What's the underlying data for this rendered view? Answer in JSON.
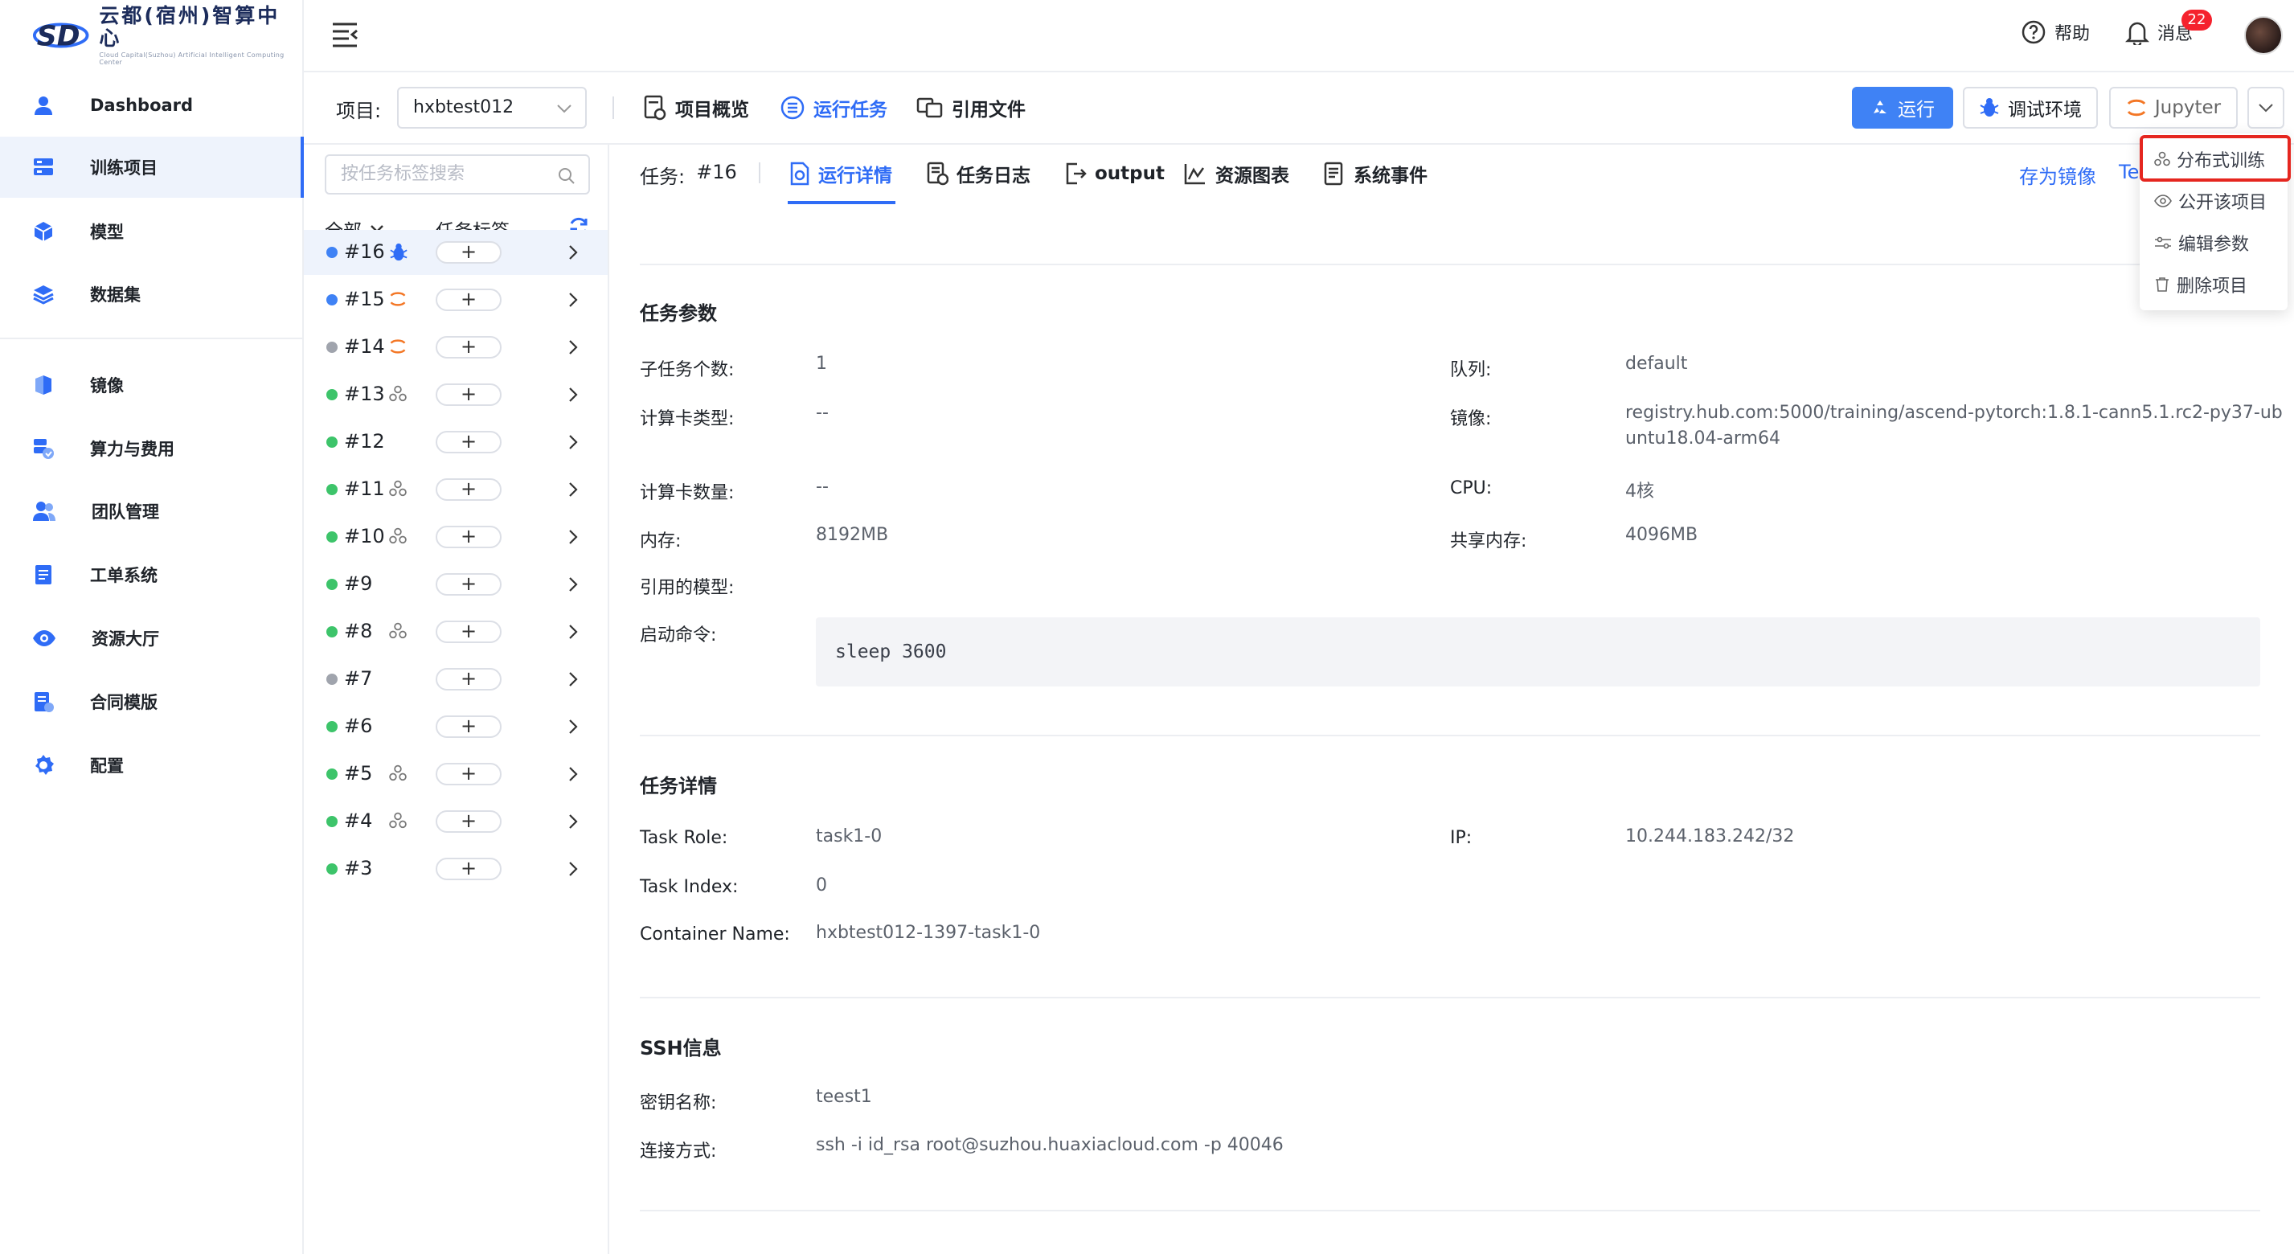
{
  "logo": {
    "brand": "云都(宿州)智算中心",
    "sub": "Cloud Capital(Suzhou) Artificial Intelligent Computing Center"
  },
  "sidebar": {
    "items": [
      {
        "label": "Dashboard",
        "icon": "user-icon"
      },
      {
        "label": "训练项目",
        "icon": "server-icon",
        "active": true
      },
      {
        "label": "模型",
        "icon": "cube-icon"
      },
      {
        "label": "数据集",
        "icon": "layers-icon"
      },
      {
        "label": "镜像",
        "icon": "image-box-icon"
      },
      {
        "label": "算力与费用",
        "icon": "compute-cost-icon"
      },
      {
        "label": "团队管理",
        "icon": "team-icon"
      },
      {
        "label": "工单系统",
        "icon": "ticket-icon"
      },
      {
        "label": "资源大厅",
        "icon": "eye-icon"
      },
      {
        "label": "合同模版",
        "icon": "contract-icon"
      },
      {
        "label": "配置",
        "icon": "gear-icon"
      }
    ]
  },
  "header": {
    "help": "帮助",
    "messages": "消息",
    "message_count": "22"
  },
  "project": {
    "label": "项目:",
    "value": "hxbtest012"
  },
  "project_tabs": [
    {
      "label": "项目概览",
      "active": false
    },
    {
      "label": "运行任务",
      "active": true
    },
    {
      "label": "引用文件",
      "active": false
    }
  ],
  "actions": {
    "run": "运行",
    "debug": "调试环境",
    "jupyter": "Jupyter"
  },
  "task_list": {
    "search_placeholder": "按任务标签搜索",
    "filter_all": "全部",
    "tag_header": "任务标签",
    "tasks": [
      {
        "id": "#16",
        "status": "running",
        "icon": "bug-icon",
        "selected": true
      },
      {
        "id": "#15",
        "status": "running",
        "icon": "jupyter-icon"
      },
      {
        "id": "#14",
        "status": "stopped",
        "icon": "jupyter-icon"
      },
      {
        "id": "#13",
        "status": "success",
        "icon": "distributed-icon"
      },
      {
        "id": "#12",
        "status": "success",
        "icon": ""
      },
      {
        "id": "#11",
        "status": "success",
        "icon": "distributed-icon"
      },
      {
        "id": "#10",
        "status": "success",
        "icon": "distributed-icon"
      },
      {
        "id": "#9",
        "status": "success",
        "icon": ""
      },
      {
        "id": "#8",
        "status": "success",
        "icon": "distributed-icon"
      },
      {
        "id": "#7",
        "status": "stopped",
        "icon": ""
      },
      {
        "id": "#6",
        "status": "success",
        "icon": ""
      },
      {
        "id": "#5",
        "status": "success",
        "icon": "distributed-icon"
      },
      {
        "id": "#4",
        "status": "success",
        "icon": "distributed-icon"
      },
      {
        "id": "#3",
        "status": "success",
        "icon": ""
      }
    ]
  },
  "status_colors": {
    "running": "#3f82f5",
    "stopped": "#a0a4ad",
    "success": "#3dc46a"
  },
  "task_detail": {
    "task_label": "任务:",
    "task_id": "#16",
    "tabs": [
      {
        "label": "运行详情",
        "active": true
      },
      {
        "label": "任务日志"
      },
      {
        "label": "output"
      },
      {
        "label": "资源图表"
      },
      {
        "label": "系统事件"
      }
    ],
    "save_image": "存为镜像",
    "save_image_truncated": "Te",
    "params": {
      "title": "任务参数",
      "subtask_count_k": "子任务个数:",
      "subtask_count_v": "1",
      "queue_k": "队列:",
      "queue_v": "default",
      "card_type_k": "计算卡类型:",
      "card_type_v": "--",
      "image_k": "镜像:",
      "image_v1": "registry.hub.com:5000/training/ascend-pytorch:1.8.1-cann5.1.rc2-py37-ub",
      "image_v2": "untu18.04-arm64",
      "card_count_k": "计算卡数量:",
      "card_count_v": "--",
      "cpu_k": "CPU:",
      "cpu_v": "4核",
      "memory_k": "内存:",
      "memory_v": "8192MB",
      "shm_k": "共享内存:",
      "shm_v": "4096MB",
      "models_k": "引用的模型:",
      "cmd_k": "启动命令:",
      "cmd_v": "sleep 3600"
    },
    "details": {
      "title": "任务详情",
      "role_k": "Task Role:",
      "role_v": "task1-0",
      "ip_k": "IP:",
      "ip_v": "10.244.183.242/32",
      "index_k": "Task Index:",
      "index_v": "0",
      "container_k": "Container Name:",
      "container_v": "hxbtest012-1397-task1-0"
    },
    "ssh": {
      "title": "SSH信息",
      "key_k": "密钥名称:",
      "key_v": "teest1",
      "conn_k": "连接方式:",
      "conn_v": "ssh -i id_rsa root@suzhou.huaxiacloud.com -p 40046"
    }
  },
  "dropdown": {
    "items": [
      "分布式训练",
      "公开该项目",
      "编辑参数",
      "删除项目"
    ]
  },
  "colors": {
    "accent": "#2f6cf6",
    "highlight": "#e5261f"
  }
}
